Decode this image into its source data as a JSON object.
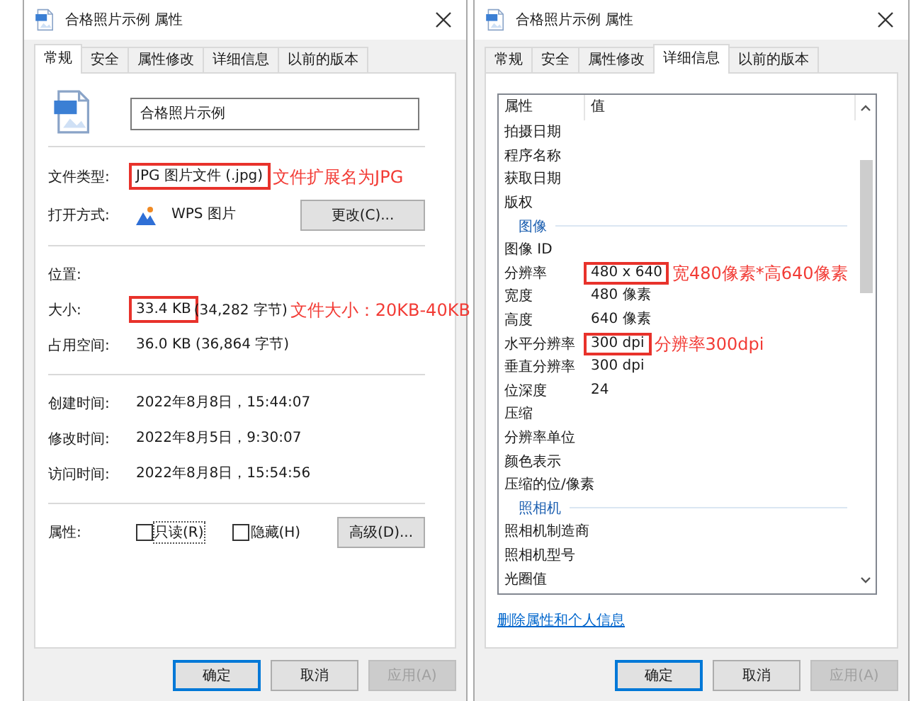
{
  "windows": [
    {
      "kind": "general",
      "title": "合格照片示例 属性",
      "tabs": [
        {
          "label": "常规",
          "selected": true
        },
        {
          "label": "安全",
          "selected": false
        },
        {
          "label": "属性修改",
          "selected": false
        },
        {
          "label": "详细信息",
          "selected": false
        },
        {
          "label": "以前的版本",
          "selected": false
        }
      ],
      "file_name": "合格照片示例",
      "sections": [
        [
          {
            "kind": "text",
            "label": "文件类型:",
            "value": "JPG 图片文件 (.jpg)",
            "highlighted": true,
            "note": "文件扩展名为JPG"
          },
          {
            "kind": "app",
            "label": "打开方式:",
            "value": "WPS 图片",
            "highlighted": false,
            "button": "更改(C)..."
          }
        ],
        [
          {
            "kind": "text",
            "label": "位置:"
          },
          {
            "kind": "text",
            "label": "大小:",
            "value": "33.4 KB",
            "detail": "(34,282 字节)",
            "highlighted": true,
            "note": "文件大小：20KB-40KB"
          },
          {
            "kind": "text",
            "label": "占用空间:",
            "value": "36.0 KB (36,864 字节)",
            "highlighted": false
          }
        ],
        [
          {
            "kind": "text",
            "label": "创建时间:",
            "value": "2022年8月8日，15:44:07",
            "highlighted": false
          },
          {
            "kind": "text",
            "label": "修改时间:",
            "value": "2022年8月5日，9:30:07",
            "highlighted": false
          },
          {
            "kind": "text",
            "label": "访问时间:",
            "value": "2022年8月8日，15:54:56",
            "highlighted": false
          }
        ]
      ],
      "attributes": {
        "label": "属性:",
        "checkboxes": [
          {
            "label": "只读(R)",
            "checked": false,
            "focused": true
          },
          {
            "label": "隐藏(H)",
            "checked": false,
            "focused": false
          }
        ],
        "button": "高级(D)..."
      },
      "buttons": [
        {
          "label": "确定",
          "default": true,
          "disabled": false
        },
        {
          "label": "取消",
          "default": false,
          "disabled": false
        },
        {
          "label": "应用(A)",
          "default": false,
          "disabled": true
        }
      ]
    },
    {
      "kind": "details",
      "title": "合格照片示例 属性",
      "tabs": [
        {
          "label": "常规",
          "selected": false
        },
        {
          "label": "安全",
          "selected": false
        },
        {
          "label": "属性修改",
          "selected": false
        },
        {
          "label": "详细信息",
          "selected": true
        },
        {
          "label": "以前的版本",
          "selected": false
        }
      ],
      "columns": [
        "属性",
        "值"
      ],
      "items": [
        {
          "kind": "row",
          "label": "拍摄日期"
        },
        {
          "kind": "row",
          "label": "程序名称"
        },
        {
          "kind": "row",
          "label": "获取日期"
        },
        {
          "kind": "row",
          "label": "版权"
        },
        {
          "kind": "group",
          "label": "图像"
        },
        {
          "kind": "row",
          "label": "图像 ID"
        },
        {
          "kind": "row",
          "label": "分辨率",
          "value": "480 x 640",
          "highlighted": true,
          "note": "宽480像素*高640像素"
        },
        {
          "kind": "row",
          "label": "宽度",
          "value": "480 像素",
          "highlighted": false
        },
        {
          "kind": "row",
          "label": "高度",
          "value": "640 像素",
          "highlighted": false
        },
        {
          "kind": "row",
          "label": "水平分辨率",
          "value": "300 dpi",
          "highlighted": true,
          "note": "分辨率300dpi"
        },
        {
          "kind": "row",
          "label": "垂直分辨率",
          "value": "300 dpi",
          "highlighted": false
        },
        {
          "kind": "row",
          "label": "位深度",
          "value": "24",
          "highlighted": false
        },
        {
          "kind": "row",
          "label": "压缩"
        },
        {
          "kind": "row",
          "label": "分辨率单位"
        },
        {
          "kind": "row",
          "label": "颜色表示"
        },
        {
          "kind": "row",
          "label": "压缩的位/像素"
        },
        {
          "kind": "group",
          "label": "照相机"
        },
        {
          "kind": "row",
          "label": "照相机制造商"
        },
        {
          "kind": "row",
          "label": "照相机型号"
        },
        {
          "kind": "row",
          "label": "光圈值"
        }
      ],
      "link": "删除属性和个人信息",
      "buttons": [
        {
          "label": "确定",
          "default": true,
          "disabled": false
        },
        {
          "label": "取消",
          "default": false,
          "disabled": false
        },
        {
          "label": "应用(A)",
          "default": false,
          "disabled": true
        }
      ]
    }
  ]
}
